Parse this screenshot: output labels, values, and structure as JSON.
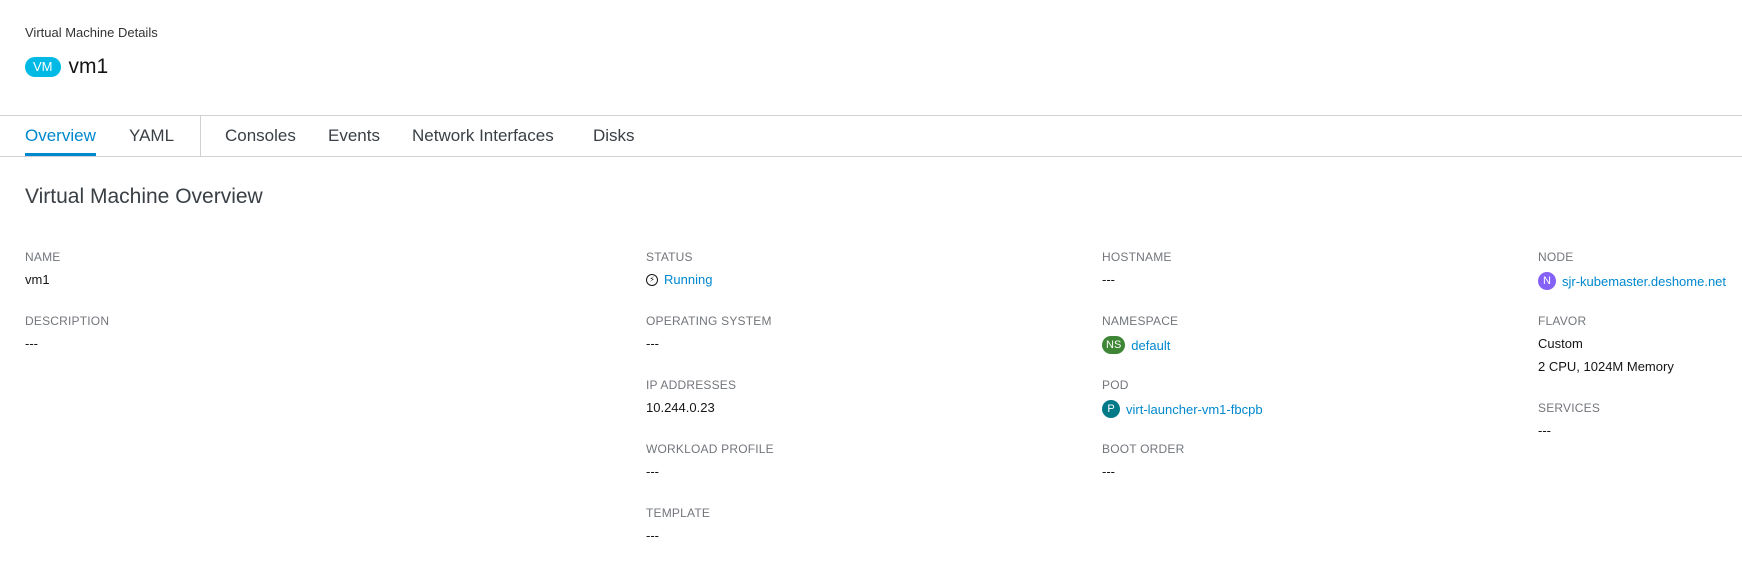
{
  "header": {
    "breadcrumb": "Virtual Machine Details",
    "vm_badge": "VM",
    "vm_name": "vm1"
  },
  "tabs": [
    {
      "label": "Overview",
      "active": true
    },
    {
      "label": "YAML"
    },
    {
      "label": "Consoles"
    },
    {
      "label": "Events"
    },
    {
      "label": "Network Interfaces"
    },
    {
      "label": "Disks"
    }
  ],
  "overview": {
    "title": "Virtual Machine Overview",
    "name": {
      "label": "NAME",
      "value": "vm1"
    },
    "description": {
      "label": "DESCRIPTION",
      "value": "---"
    },
    "status": {
      "label": "STATUS",
      "value": "Running"
    },
    "operating_system": {
      "label": "OPERATING SYSTEM",
      "value": "---"
    },
    "ip_addresses": {
      "label": "IP ADDRESSES",
      "value": "10.244.0.23"
    },
    "workload_profile": {
      "label": "WORKLOAD PROFILE",
      "value": "---"
    },
    "template": {
      "label": "TEMPLATE",
      "value": "---"
    },
    "hostname": {
      "label": "HOSTNAME",
      "value": "---"
    },
    "namespace": {
      "label": "NAMESPACE",
      "badge": "NS",
      "value": "default"
    },
    "pod": {
      "label": "POD",
      "badge": "P",
      "value": "virt-launcher-vm1-fbcpb"
    },
    "boot_order": {
      "label": "BOOT ORDER",
      "value": "---"
    },
    "node": {
      "label": "NODE",
      "badge": "N",
      "value": "sjr-kubemaster.deshome.net"
    },
    "flavor": {
      "label": "FLAVOR",
      "value": "Custom",
      "detail": "2 CPU, 1024M Memory"
    },
    "services": {
      "label": "SERVICES",
      "value": "---"
    }
  },
  "colors": {
    "vm_badge": "#00b9e4",
    "ns_badge": "#3e8635",
    "pod_badge": "#007a87",
    "node_badge": "#8461f7",
    "link": "#0088ce"
  }
}
